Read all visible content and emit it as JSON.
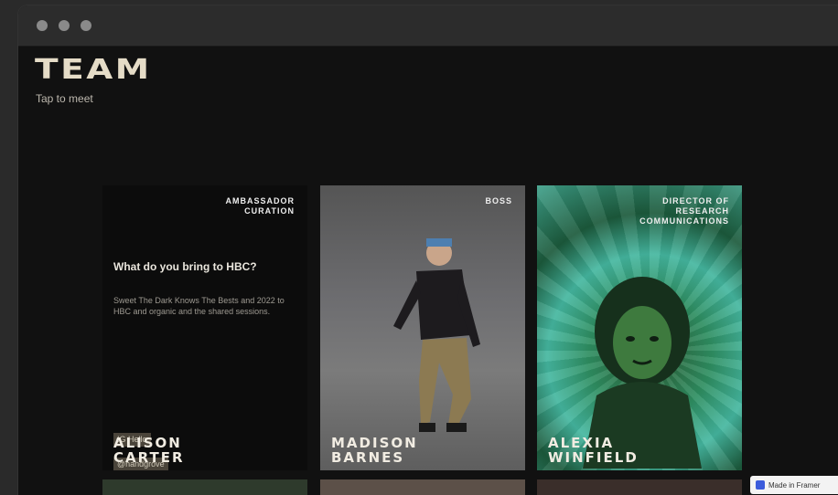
{
  "page": {
    "title": "TEAM",
    "subtitle": "Tap to meet"
  },
  "cards": [
    {
      "role": "AMBASSADOR\nCURATION",
      "question": "What do you bring to HBC?",
      "answer": "Sweet The Dark Knows The Bests and 2022 to HBC and organic and the shared sessions.",
      "tags": [
        "IG Hello",
        "@handgrove"
      ],
      "name": "ALISON\nCARTER"
    },
    {
      "role": "BOSS",
      "name": "MADISON\nBARNES"
    },
    {
      "role": "DIRECTOR OF\nRESEARCH\nCOMMUNICATIONS",
      "name": "ALEXIA\nWINFIELD"
    }
  ],
  "badge": {
    "label": "Made in Framer"
  }
}
